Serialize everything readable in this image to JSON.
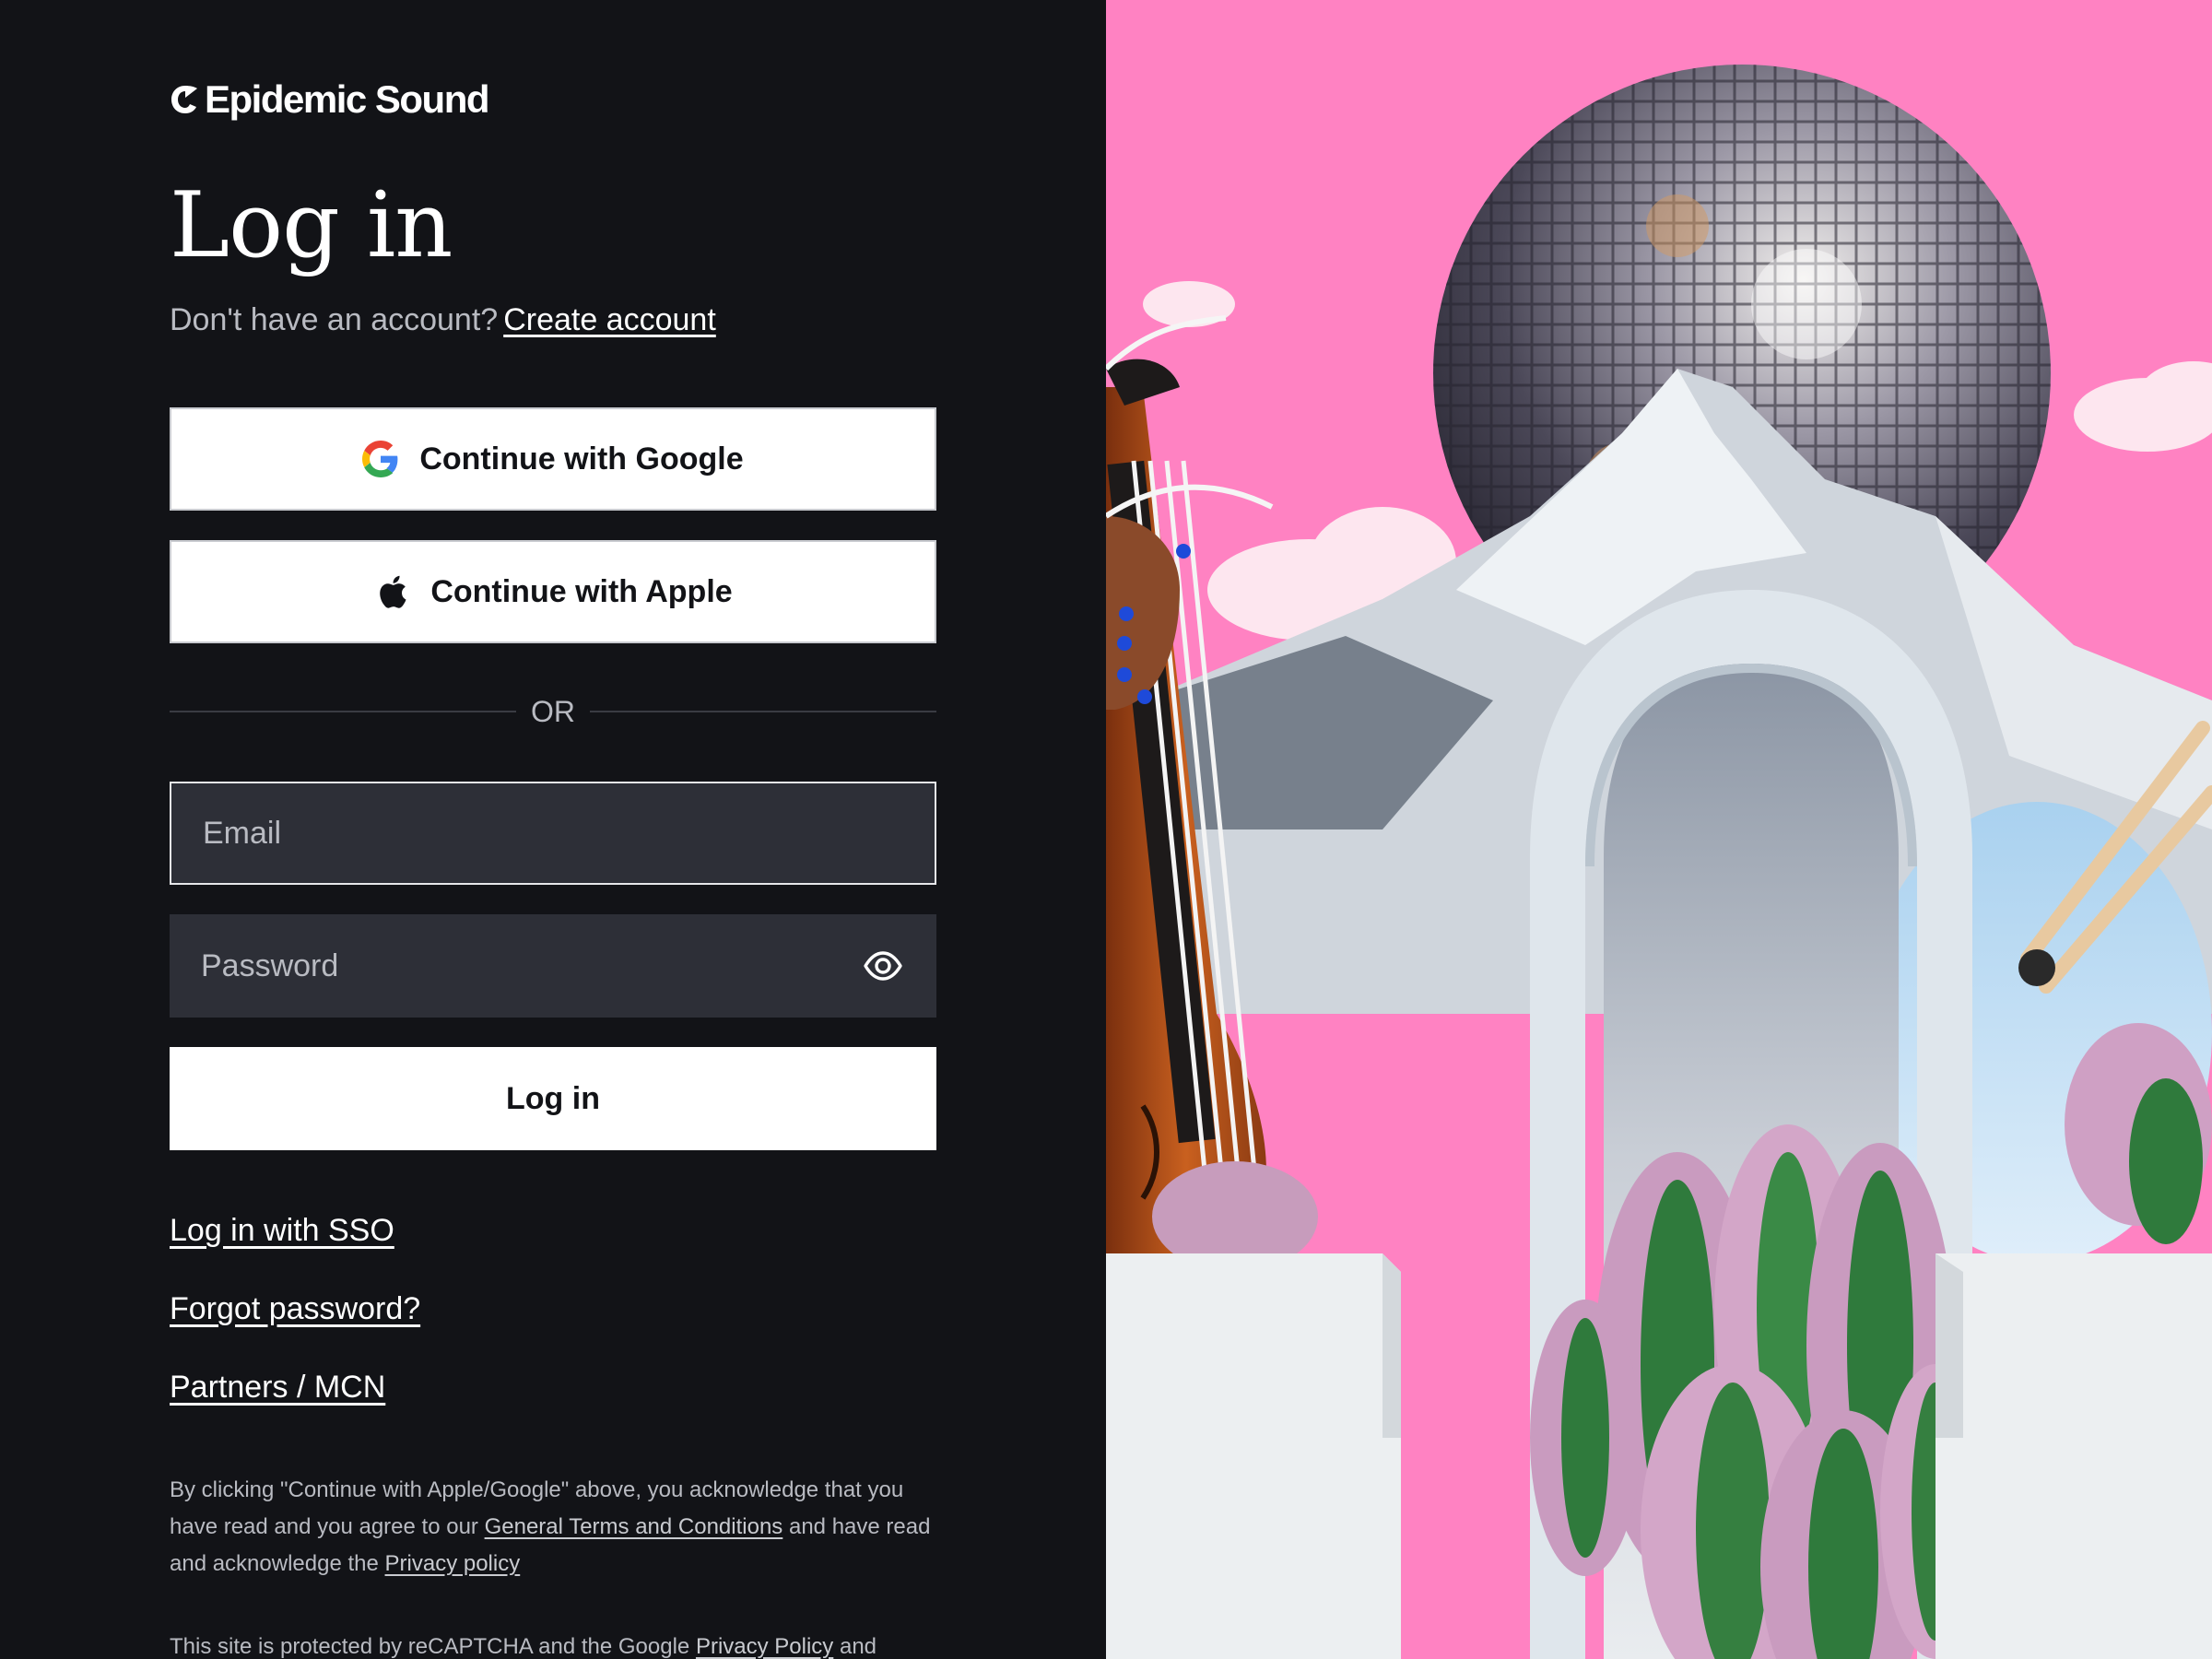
{
  "brand": {
    "name": "Epidemic Sound"
  },
  "page": {
    "title": "Log in",
    "no_account_text": "Don't have an account?",
    "create_account": "Create account"
  },
  "social": {
    "google": "Continue with Google",
    "apple": "Continue with Apple"
  },
  "divider": "OR",
  "form": {
    "email_placeholder": "Email",
    "password_placeholder": "Password",
    "login_button": "Log in"
  },
  "links": {
    "sso": "Log in with SSO",
    "forgot": "Forgot password?",
    "partners": "Partners / MCN"
  },
  "legal": {
    "p1_a": "By clicking \"Continue with Apple/Google\" above, you acknowledge that you have read and you agree to our ",
    "p1_terms": "General Terms and Conditions",
    "p1_b": " and have read and acknowledge the ",
    "p1_privacy": "Privacy policy",
    "p2_a": "This site is protected by reCAPTCHA and the Google ",
    "p2_privacy": "Privacy Policy",
    "p2_b": " and"
  },
  "colors": {
    "background": "#121317",
    "input_bg": "#2d2f37",
    "sky_pink": "#ff82c2",
    "muted_text": "#b9bbc2"
  },
  "icons": [
    "epidemic-sound-logo-icon",
    "google-icon",
    "apple-icon",
    "eye-icon"
  ]
}
